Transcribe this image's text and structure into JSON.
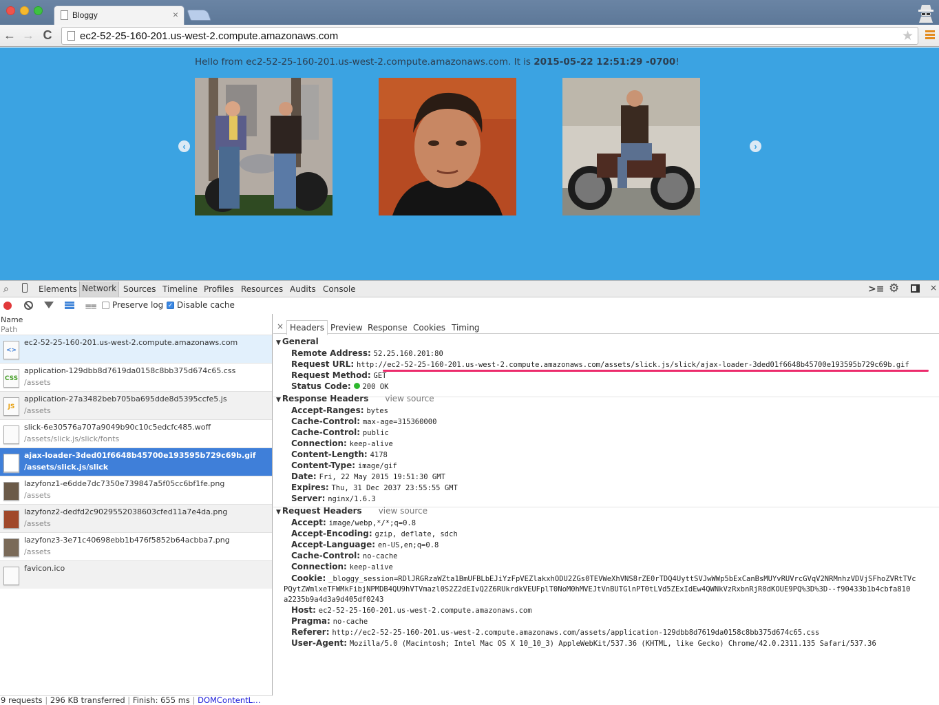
{
  "browser": {
    "tab_title": "Bloggy",
    "tab_close": "×",
    "url": "ec2-52-25-160-201.us-west-2.compute.amazonaws.com",
    "nav": {
      "back": "←",
      "forward": "→",
      "reload": "C"
    },
    "star": "★"
  },
  "page": {
    "hello_prefix": "Hello from ec2-52-25-160-201.us-west-2.compute.amazonaws.com. It is ",
    "hello_time": "2015-05-22 12:51:29 -0700",
    "hello_suffix": "!",
    "prev_arrow": "‹",
    "next_arrow": "›",
    "slides": [
      "lazyfonz1",
      "lazyfonz2",
      "lazyfonz3"
    ],
    "background": "#3ba3e2"
  },
  "devtools": {
    "tabs": [
      "Elements",
      "Network",
      "Sources",
      "Timeline",
      "Profiles",
      "Resources",
      "Audits",
      "Console"
    ],
    "active_tab": "Network",
    "close": "×",
    "preserve_log": {
      "label": "Preserve log",
      "checked": false
    },
    "disable_cache": {
      "label": "Disable cache",
      "checked": true
    },
    "list_header": {
      "name": "Name",
      "path": "Path"
    },
    "requests": [
      {
        "name": "ec2-52-25-160-201.us-west-2.compute.amazonaws.com",
        "path": "",
        "icon": "html-doc-icon",
        "icon_text": "<>"
      },
      {
        "name": "application-129dbb8d7619da0158c8bb375d674c65.css",
        "path": "/assets",
        "icon": "css-file-icon",
        "icon_text": "CSS"
      },
      {
        "name": "application-27a3482beb705ba695dde8d5395ccfe5.js",
        "path": "/assets",
        "icon": "js-file-icon",
        "icon_text": "JS"
      },
      {
        "name": "slick-6e30576a707a9049b90c10c5edcfc485.woff",
        "path": "/assets/slick.js/slick/fonts",
        "icon": "font-file-icon",
        "icon_text": ""
      },
      {
        "name": "ajax-loader-3ded01f6648b45700e193595b729c69b.gif",
        "path": "/assets/slick.js/slick",
        "icon": "gif-thumbnail-icon",
        "icon_text": ""
      },
      {
        "name": "lazyfonz1-e6dde7dc7350e739847a5f05cc6bf1fe.png",
        "path": "/assets",
        "icon": "image-thumbnail-icon",
        "icon_text": ""
      },
      {
        "name": "lazyfonz2-dedfd2c9029552038603cfed11a7e4da.png",
        "path": "/assets",
        "icon": "image-thumbnail-icon",
        "icon_text": ""
      },
      {
        "name": "lazyfonz3-3e71c40698ebb1b476f5852b64acbba7.png",
        "path": "/assets",
        "icon": "image-thumbnail-icon",
        "icon_text": ""
      },
      {
        "name": "favicon.ico",
        "path": "",
        "icon": "blank-file-icon",
        "icon_text": ""
      }
    ],
    "selected_request": 4,
    "status_bar": {
      "requests": "9 requests",
      "transferred": "296 KB transferred",
      "finish": "Finish: 655 ms",
      "domcontent": "DOMContentL…",
      "sep": "|"
    },
    "detail_tabs": [
      "Headers",
      "Preview",
      "Response",
      "Cookies",
      "Timing"
    ],
    "active_detail_tab": "Headers",
    "general": {
      "title": "General",
      "rows": [
        {
          "k": "Remote Address:",
          "v": "52.25.160.201:80"
        },
        {
          "k": "Request URL:",
          "v": "http://ec2-52-25-160-201.us-west-2.compute.amazonaws.com/assets/slick.js/slick/ajax-loader-3ded01f6648b45700e193595b729c69b.gif"
        },
        {
          "k": "Request Method:",
          "v": "GET"
        },
        {
          "k": "Status Code:",
          "v": "200 OK"
        }
      ]
    },
    "response_headers": {
      "title": "Response Headers",
      "view_source": "view source",
      "rows": [
        {
          "k": "Accept-Ranges:",
          "v": "bytes"
        },
        {
          "k": "Cache-Control:",
          "v": "max-age=315360000"
        },
        {
          "k": "Cache-Control:",
          "v": "public"
        },
        {
          "k": "Connection:",
          "v": "keep-alive"
        },
        {
          "k": "Content-Length:",
          "v": "4178"
        },
        {
          "k": "Content-Type:",
          "v": "image/gif"
        },
        {
          "k": "Date:",
          "v": "Fri, 22 May 2015 19:51:30 GMT"
        },
        {
          "k": "Expires:",
          "v": "Thu, 31 Dec 2037 23:55:55 GMT"
        },
        {
          "k": "Server:",
          "v": "nginx/1.6.3"
        }
      ]
    },
    "request_headers": {
      "title": "Request Headers",
      "view_source": "view source",
      "rows_before_cookie": [
        {
          "k": "Accept:",
          "v": "image/webp,*/*;q=0.8"
        },
        {
          "k": "Accept-Encoding:",
          "v": "gzip, deflate, sdch"
        },
        {
          "k": "Accept-Language:",
          "v": "en-US,en;q=0.8"
        },
        {
          "k": "Cache-Control:",
          "v": "no-cache"
        },
        {
          "k": "Connection:",
          "v": "keep-alive"
        }
      ],
      "cookie": {
        "k": "Cookie:",
        "line1": "_bloggy_session=RDlJRGRzaWZta1BmUFBLbEJiYzFpVEZlakxhODU2ZGs0TEVWeXhVNS8rZE0rTDQ4UyttSVJwWWp5bExCanBsMUYvRUVrcGVqV2NRMnhzVDVjSFhoZVRtTVc",
        "line2": "PQytZWmlxeTFWMkFibjNPMDB4QU9hVTVmazl0S2Z2dEIvQ2Z6RUkrdkVEUFplT0NoM0hMVEJtVnBUTGlnPT0tLVd5ZExIdEw4QWNkVzRxbnRjR0dKOUE9PQ%3D%3D--f90433b1b4cbfa810",
        "line3": "a2235b9a4d3a9d405df0243"
      },
      "rows_after_cookie": [
        {
          "k": "Host:",
          "v": "ec2-52-25-160-201.us-west-2.compute.amazonaws.com"
        },
        {
          "k": "Pragma:",
          "v": "no-cache"
        },
        {
          "k": "Referer:",
          "v": "http://ec2-52-25-160-201.us-west-2.compute.amazonaws.com/assets/application-129dbb8d7619da0158c8bb375d674c65.css"
        },
        {
          "k": "User-Agent:",
          "v": "Mozilla/5.0 (Macintosh; Intel Mac OS X 10_10_3) AppleWebKit/537.36 (KHTML, like Gecko) Chrome/42.0.2311.135 Safari/537.36"
        }
      ]
    },
    "colors": {
      "selected_row": "#3f7fd9",
      "annotation_underline": "#ec2b6c",
      "status_ok": "#2eb82e"
    }
  }
}
